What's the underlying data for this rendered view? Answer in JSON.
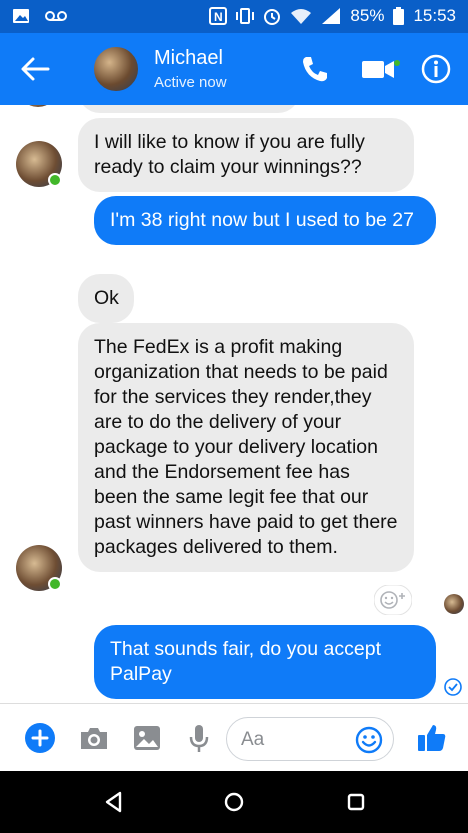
{
  "status_bar": {
    "battery": "85%",
    "time": "15:53",
    "icons": [
      "image-notification-icon",
      "voicemail-icon",
      "nfc-icon",
      "vibrate-icon",
      "alarm-icon",
      "wifi-icon",
      "signal-icon",
      "battery-icon"
    ]
  },
  "header": {
    "contact_name": "Michael",
    "contact_status": "Active now",
    "icons": [
      "back-arrow-icon",
      "phone-icon",
      "video-camera-icon",
      "info-icon"
    ],
    "accent": "#0f7bf8"
  },
  "messages": [
    {
      "direction": "incoming",
      "text": "I will like to know if you are fully ready to claim your winnings??"
    },
    {
      "direction": "outgoing",
      "text": "I'm 38 right now but I used to be 27"
    },
    {
      "direction": "incoming",
      "text": "Ok"
    },
    {
      "direction": "incoming",
      "text": "The FedEx is a profit making organization that needs to be paid for the services they render,they are to do the delivery of your package to your delivery location and the  Endorsement fee has been the same legit fee that our past winners have paid to get there packages delivered to them."
    },
    {
      "direction": "outgoing",
      "text": "That sounds fair, do you accept PalPay"
    }
  ],
  "composer": {
    "placeholder": "Aa",
    "icons": [
      "plus-icon",
      "camera-icon",
      "gallery-icon",
      "microphone-icon",
      "emoji-icon",
      "thumbs-up-icon"
    ]
  },
  "colors": {
    "incoming_bubble": "#ebebeb",
    "outgoing_bubble": "#0f7bf8",
    "online": "#42b72a"
  }
}
